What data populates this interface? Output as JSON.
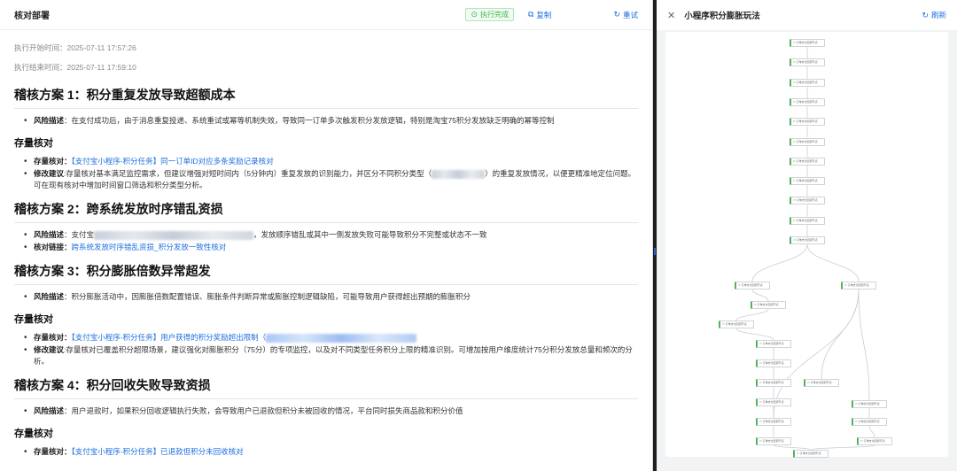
{
  "left": {
    "title": "核对部署",
    "status_badge": "执行完成",
    "copy_label": "复制",
    "retry_label": "重试",
    "start_time": "执行开始时间：2025-07-11 17:57:26",
    "end_time": "执行结束时间：2025-07-11 17:59:10",
    "s1": {
      "title": "稽核方案 1：积分重复发放导致超额成本",
      "risk_label": "风险描述",
      "risk_text": "：在支付成功后，由于消息重复投递、系统重试或幂等机制失效，导致同一订单多次触发积分发放逻辑，特别是淘宝75积分发放缺乏明确的幂等控制",
      "sub": "存量核对",
      "check_label": "存量核对",
      "check_link": "【支付宝小程序-积分任务】同一订单ID对应多条奖励记录核对",
      "fix_label": "修改建议",
      "fix_text_a": ":存量核对基本满足监控需求，但建议增强对短时间内（5分钟内）重复发放的识别能力，并区分不同积分类型（",
      "fix_text_b": "）的重复发放情况，以便更精准地定位问题。可在现有核对中增加时间窗口筛选和积分类型分析。"
    },
    "s2": {
      "title": "稽核方案 2：跨系统发放时序错乱资损",
      "risk_label": "风险描述",
      "risk_text_a": "：支付宝",
      "risk_text_b": "，发放顺序错乱或其中一侧发放失败可能导致积分不完整或状态不一致",
      "link_label": "核对链接",
      "link_text": "跨系统发放时序错乱资损_积分发放一致性核对"
    },
    "s3": {
      "title": "稽核方案 3：积分膨胀倍数异常超发",
      "risk_label": "风险描述",
      "risk_text": "：积分膨胀活动中，因膨胀倍数配置错误、膨胀条件判断异常或膨胀控制逻辑缺陷，可能导致用户获得超出预期的膨胀积分",
      "sub": "存量核对",
      "check_label": "存量核对",
      "check_link": "【支付宝小程序-积分任务】用户获得的积分奖励超出限制（",
      "fix_label": "修改建议",
      "fix_text": ":存量核对已覆盖积分超限场景，建议强化对膨胀积分（75分）的专项监控，以及对不同类型任务积分上限的精准识别。可增加按用户维度统计75分积分发放总量和频次的分析。"
    },
    "s4": {
      "title": "稽核方案 4：积分回收失败导致资损",
      "risk_label": "风险描述",
      "risk_text": "：用户退款时，如果积分回收逻辑执行失败，会导致用户已退款但积分未被回收的情况，平台同时损失商品款和积分价值",
      "sub": "存量核对",
      "cut_label": "存量核对",
      "cut_link": "【支付宝小程序-积分任务】已退款但积分未回收核对"
    }
  },
  "right": {
    "title": "小程序积分膨胀玩法",
    "refresh_label": "刷新",
    "node_text": "▭ 订单支付回调节点"
  },
  "colors": {
    "accent": "#1e6fe0",
    "success": "#3bb54a",
    "node_border": "#4fb35e"
  }
}
